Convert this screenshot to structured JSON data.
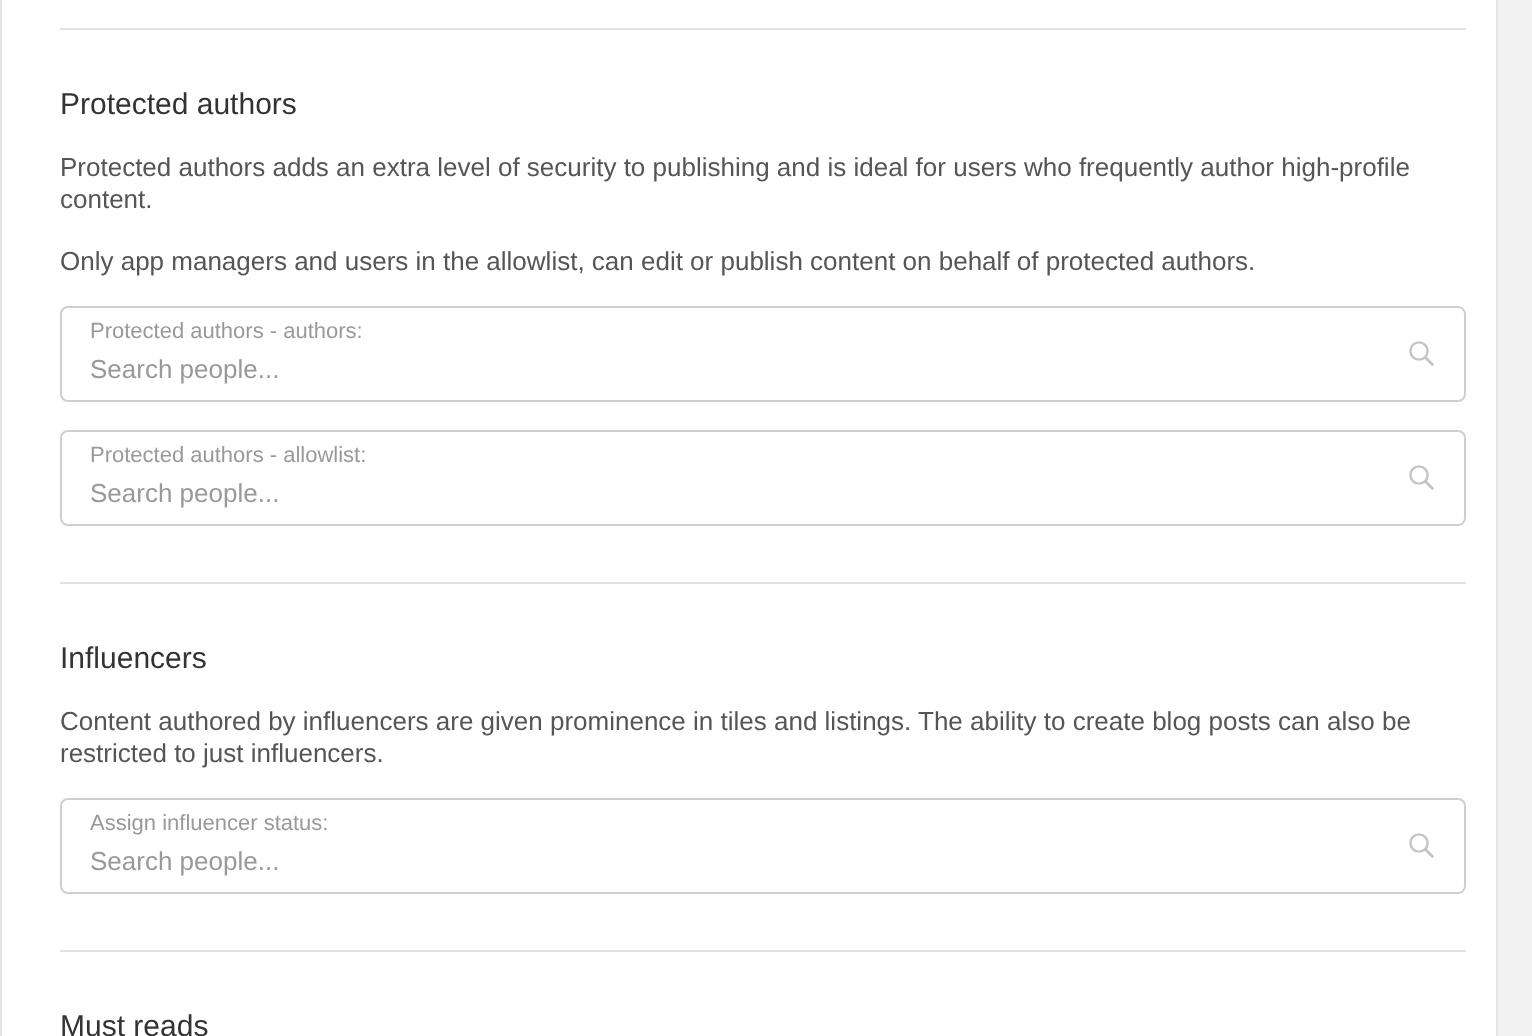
{
  "sections": [
    {
      "title": "Protected authors",
      "paragraphs": [
        "Protected authors adds an extra level of security to publishing and is ideal for users who frequently author high-profile content.",
        "Only app managers and users in the allowlist, can edit or publish content on behalf of protected authors."
      ],
      "fields": [
        {
          "label": "Protected authors - authors:",
          "placeholder": "Search people..."
        },
        {
          "label": "Protected authors - allowlist:",
          "placeholder": "Search people..."
        }
      ]
    },
    {
      "title": "Influencers",
      "paragraphs": [
        "Content authored by influencers are given prominence in tiles and listings. The ability to create blog posts can also be restricted to just influencers."
      ],
      "fields": [
        {
          "label": "Assign influencer status:",
          "placeholder": "Search people..."
        }
      ]
    },
    {
      "title": "Must reads"
    }
  ]
}
